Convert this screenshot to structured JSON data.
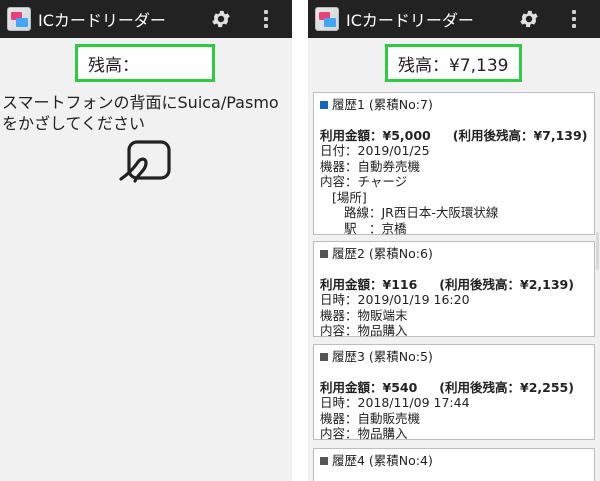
{
  "app": {
    "title": "ICカードリーダー",
    "gear_icon": "settings-gear-icon",
    "menu_icon": "overflow-menu-icon"
  },
  "colors": {
    "appbar": "#222222",
    "accent_border": "#2ecc40",
    "history1_marker": "#1565c0",
    "history_marker": "#555555"
  },
  "left_screen": {
    "balance": "残高：",
    "instruction": "スマートフォンの背面にSuica/Pasmoをかざしてください",
    "nfc_icon": "nfc-tap-icon"
  },
  "right_screen": {
    "balance": "残高：¥7,139",
    "history": [
      {
        "header": "履歴1 (累積No:7)",
        "amount": "利用金額：¥5,000",
        "after": "(利用後残高：¥7,139)",
        "date": "日付：2019/01/25",
        "device": "機器：自動券売機",
        "content": "内容：チャージ",
        "place_label": "[場所]",
        "line": "路線：JR西日本-大阪環状線",
        "station": "駅　：京橋"
      },
      {
        "header": "履歴2 (累積No:6)",
        "amount": "利用金額：¥116",
        "after": "(利用後残高：¥2,139)",
        "date": "日時：2019/01/19 16:20",
        "device": "機器：物販端末",
        "content": "内容：物品購入"
      },
      {
        "header": "履歴3 (累積No:5)",
        "amount": "利用金額：¥540",
        "after": "(利用後残高：¥2,255)",
        "date": "日時：2018/11/09 17:44",
        "device": "機器：自動販売機",
        "content": "内容：物品購入"
      },
      {
        "header": "履歴4 (累積No:4)"
      }
    ]
  }
}
